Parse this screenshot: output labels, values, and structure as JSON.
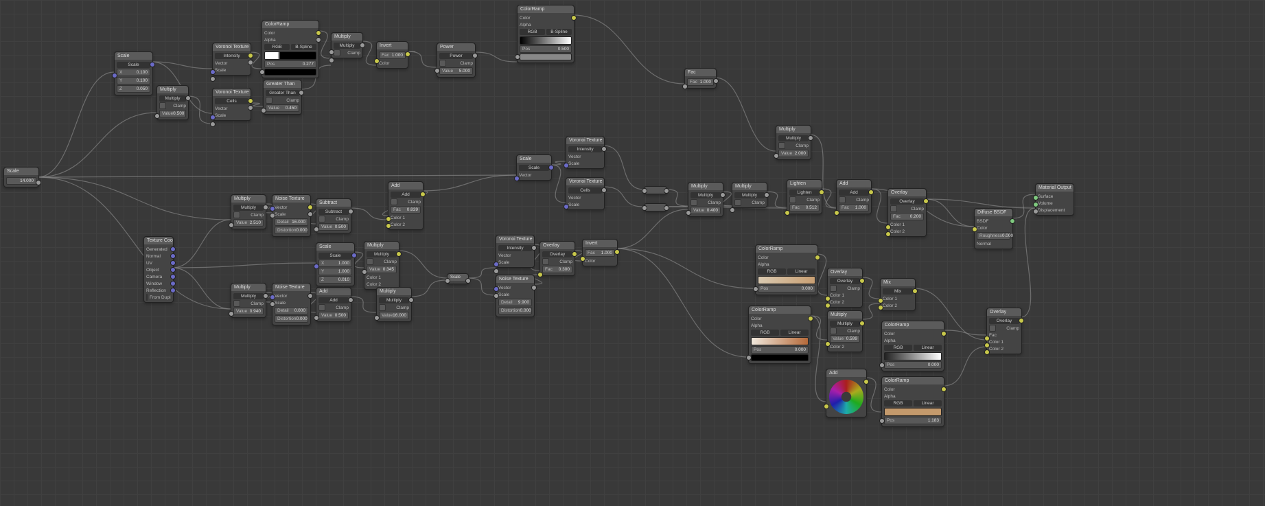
{
  "labels": {
    "multiply": "Multiply",
    "clamp": "Clamp",
    "value": "Value",
    "color": "Color",
    "color1": "Color 1",
    "color2": "Color 2",
    "vector": "Vector",
    "scale": "Scale",
    "fac": "Fac",
    "alpha": "Alpha",
    "detail": "Detail",
    "distortion": "Distortion",
    "intensity": "Intensity",
    "cells": "Cells",
    "roughness": "Roughness",
    "surface": "Surface",
    "volume": "Volume",
    "displacement": "Displacement",
    "bsdf": "BSDF",
    "normal": "Normal",
    "pos": "Pos",
    "rgb": "RGB",
    "bspline": "B-Spline",
    "linear": "Linear",
    "greater_than": "Greater Than",
    "subtract": "Subtract",
    "add": "Add",
    "power": "Power",
    "overlay": "Overlay",
    "lighten": "Lighten",
    "mix": "Mix",
    "generated": "Generated",
    "uv": "UV",
    "object": "Object",
    "camera": "Camera",
    "window": "Window",
    "reflection": "Reflection",
    "from_dupli": "From Dupli",
    "x": "X",
    "y": "Y",
    "z": "Z"
  },
  "nodes": {
    "scale1": {
      "title": "Scale",
      "value": "14.000"
    },
    "sep1": {
      "title": "Scale",
      "scale_label": "Scale",
      "x": "0.100",
      "y": "0.100",
      "z": "0.050"
    },
    "mul_top": {
      "title": "Multiply",
      "value": "0.500"
    },
    "voronoi1": {
      "title": "Voronoi Texture"
    },
    "voronoi1b": {
      "title": "Voronoi Texture"
    },
    "colorramp_top": {
      "title": "ColorRamp",
      "pos": "0.277"
    },
    "greater": {
      "title": "Greater Than",
      "value": "0.450"
    },
    "mul_after_ramp": {
      "title": "Multiply"
    },
    "invert_top": {
      "title": "Invert",
      "fac": "1.000"
    },
    "power": {
      "title": "Power",
      "value": "5.000"
    },
    "colorramp_big": {
      "title": "ColorRamp",
      "pos": "0.500"
    },
    "fac_right": {
      "title": "Fac",
      "fac": "1.000"
    },
    "texcoord": {
      "title": "Texture Coord"
    },
    "mul_l1": {
      "title": "Multiply",
      "value": "2.510"
    },
    "mul_l2": {
      "title": "Multiply",
      "value": "0.940"
    },
    "noise1": {
      "title": "Noise Texture",
      "detail": "16.000",
      "distortion": "0.000"
    },
    "noise2": {
      "title": "Noise Texture",
      "detail": "0.000",
      "distortion": "0.000"
    },
    "sub1": {
      "title": "Subtract",
      "value": "0.500"
    },
    "add2": {
      "title": "Add",
      "value": "0.500"
    },
    "sep2": {
      "title": "Scale",
      "scale_label": "Scale",
      "x": "1.000",
      "y": "1.000",
      "z": "0.010"
    },
    "add_mid": {
      "title": "Add",
      "fac": "0.839"
    },
    "mul_mid": {
      "title": "Multiply",
      "value": "0.345"
    },
    "mul_low": {
      "title": "Multiply",
      "value": "16.000"
    },
    "scale_knob": {
      "title": "Scale"
    },
    "voronoi3": {
      "title": "Voronoi Texture"
    },
    "noise3": {
      "title": "Noise Texture",
      "detail": "9.900",
      "distortion": "0.000"
    },
    "overlay1": {
      "title": "Overlay",
      "fac": "0.300"
    },
    "invert_mid": {
      "title": "Invert",
      "fac": "1.000"
    },
    "voronoi4": {
      "title": "Voronoi Texture"
    },
    "voronoi5": {
      "title": "Voronoi Texture"
    },
    "scale_mid": {
      "title": "Scale"
    },
    "mul_r1": {
      "title": "Multiply",
      "value": "0.400"
    },
    "mul_r2": {
      "title": "Multiply"
    },
    "lighten": {
      "title": "Lighten",
      "fac": "0.512"
    },
    "add_r": {
      "title": "Add",
      "fac": "1.000"
    },
    "mul_far": {
      "title": "Multiply",
      "value": "2.000"
    },
    "overlay_r": {
      "title": "Overlay",
      "fac": "0.200"
    },
    "colorramp_r1": {
      "title": "ColorRamp",
      "pos": "0.000"
    },
    "colorramp_r2": {
      "title": "ColorRamp",
      "pos": "0.000"
    },
    "colorramp_r3": {
      "title": "ColorRamp",
      "pos": "0.000"
    },
    "colorramp_r4": {
      "title": "ColorRamp",
      "pos": "1.183"
    },
    "overlay_r2": {
      "title": "Overlay"
    },
    "mul_r3": {
      "title": "Multiply",
      "value": "0.599"
    },
    "mix": {
      "title": "Mix"
    },
    "add_wheel": {
      "title": "Add"
    },
    "diffuse": {
      "title": "Diffuse BSDF",
      "roughness": "0.000"
    },
    "overlay_far": {
      "title": "Overlay"
    },
    "output": {
      "title": "Material Output"
    },
    "reroute1": {
      "title": ""
    },
    "reroute2": {
      "title": ""
    }
  }
}
